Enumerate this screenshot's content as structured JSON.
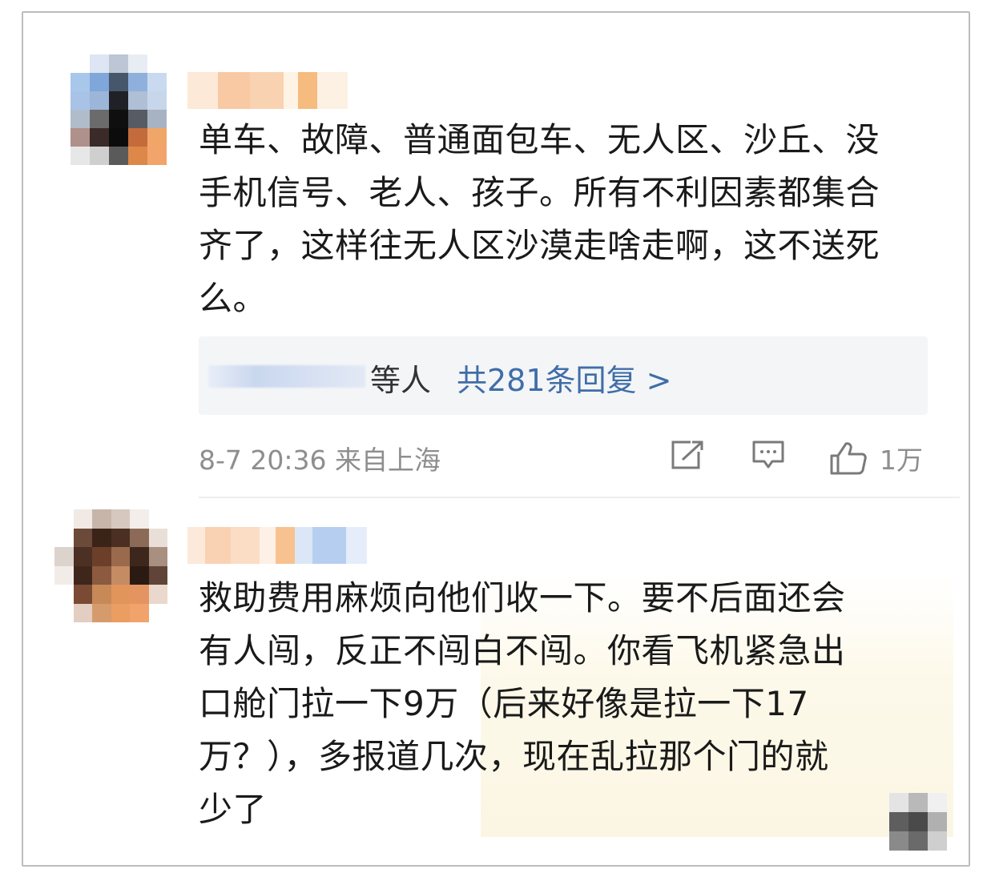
{
  "comments": [
    {
      "text": "单车、故障、普通面包车、无人区、沙丘、没\n手机信号、老人、孩子。所有不利因素都集合\n齐了，这样往无人区沙漠走啥走啊，这不送死\n么。",
      "replies": {
        "suffix": "等人",
        "link": "共281条回复 >"
      },
      "meta": "8-7 20:36 来自上海",
      "like_count": "1万"
    },
    {
      "text": "救助费用麻烦向他们收一下。要不后面还会\n有人闯，反正不闯白不闯。你看飞机紧急出\n口舱门拉一下9万（后来好像是拉一下17\n万？），多报道几次，现在乱拉那个门的就\n少了"
    }
  ],
  "icons": {
    "share": "share-icon",
    "comment": "comment-icon",
    "like": "thumbs-up-icon"
  },
  "colors": {
    "link": "#3f6ea8",
    "meta": "#8e8e8e",
    "text": "#1a1a1a"
  }
}
